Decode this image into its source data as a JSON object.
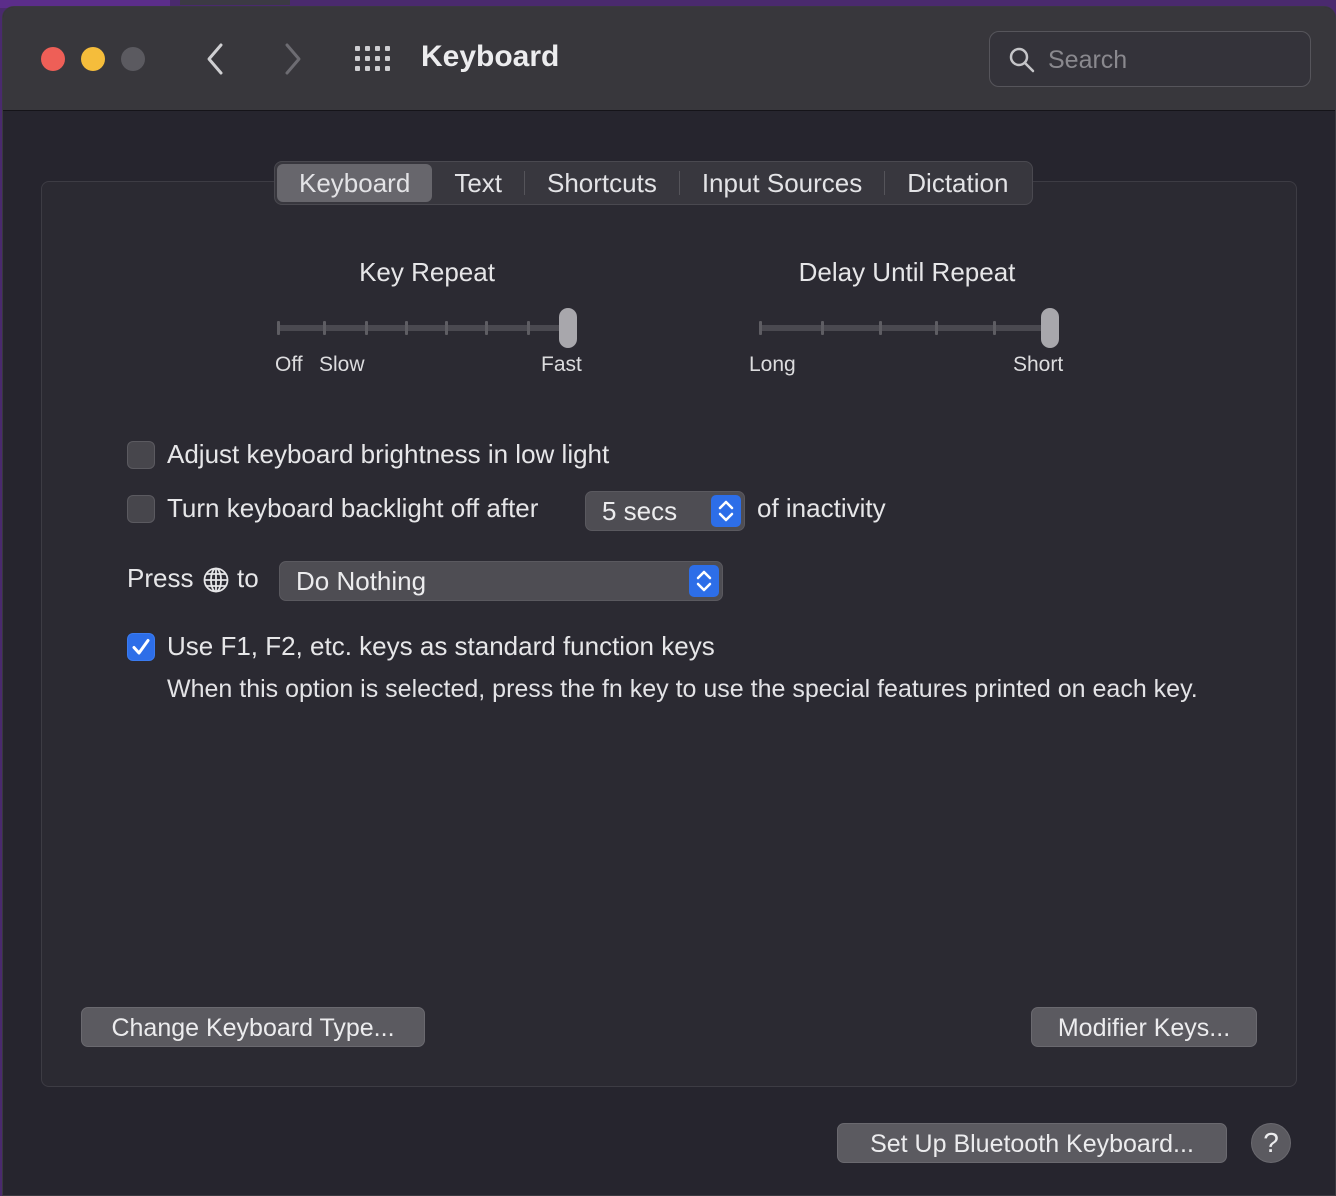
{
  "window": {
    "title": "Keyboard",
    "search_placeholder": "Search"
  },
  "tabs": [
    {
      "label": "Keyboard",
      "selected": true
    },
    {
      "label": "Text",
      "selected": false
    },
    {
      "label": "Shortcuts",
      "selected": false
    },
    {
      "label": "Input Sources",
      "selected": false
    },
    {
      "label": "Dictation",
      "selected": false
    }
  ],
  "key_repeat": {
    "title": "Key Repeat",
    "label_off": "Off",
    "label_slow": "Slow",
    "label_fast": "Fast",
    "level": 1.0
  },
  "delay_until_repeat": {
    "title": "Delay Until Repeat",
    "label_long": "Long",
    "label_short": "Short",
    "level": 1.0
  },
  "options": {
    "brightness_label": "Adjust keyboard brightness in low light",
    "brightness_checked": false,
    "backlight_label": "Turn keyboard backlight off after",
    "backlight_checked": false,
    "backlight_value": "5 secs",
    "backlight_suffix": "of inactivity",
    "press_label": "Press",
    "press_to": "to",
    "press_value": "Do Nothing",
    "fkeys_label": "Use F1, F2, etc. keys as standard function keys",
    "fkeys_checked": true,
    "fkeys_note": "When this option is selected, press the fn key to use the special features printed on each key."
  },
  "buttons": {
    "change_type": "Change Keyboard Type...",
    "modifier_keys": "Modifier Keys...",
    "bluetooth": "Set Up Bluetooth Keyboard...",
    "help": "?"
  },
  "colors": {
    "accent": "#2d6ee8",
    "close": "#ee5f57",
    "minimize": "#f5bd3b"
  }
}
